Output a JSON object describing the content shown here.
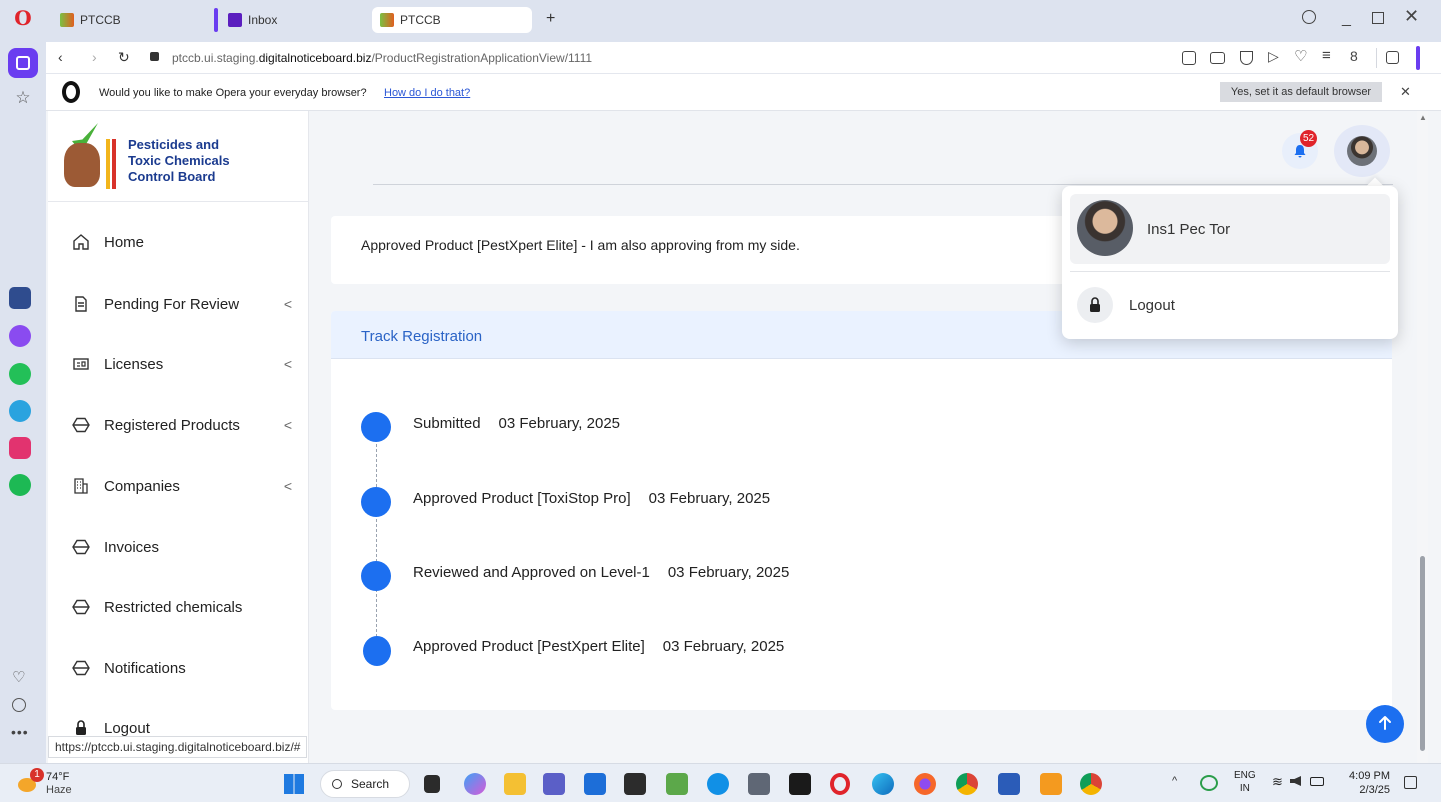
{
  "browser": {
    "tabs": [
      {
        "label": "PTCCB"
      },
      {
        "label": "Inbox"
      },
      {
        "label": "PTCCB"
      }
    ],
    "url_prefix": "ptccb.ui.staging.",
    "url_domain": "digitalnoticeboard.biz",
    "url_path": "/ProductRegistrationApplicationView/1111",
    "infobar": {
      "question": "Would you like to make Opera your everyday browser?",
      "link": "How do I do that?",
      "button": "Yes, set it as default browser"
    },
    "status_url": "https://ptccb.ui.staging.digitalnoticeboard.biz/#"
  },
  "brand": {
    "line1": "Pesticides and",
    "line2": "Toxic Chemicals",
    "line3": "Control Board"
  },
  "sidebar": {
    "items": [
      {
        "label": "Home",
        "icon": "home-icon"
      },
      {
        "label": "Pending For Review",
        "icon": "document-icon",
        "chevron": "<"
      },
      {
        "label": "Licenses",
        "icon": "id-card-icon",
        "chevron": "<"
      },
      {
        "label": "Registered Products",
        "icon": "hexagon-icon",
        "chevron": "<"
      },
      {
        "label": "Companies",
        "icon": "building-icon",
        "chevron": "<"
      },
      {
        "label": "Invoices",
        "icon": "hexagon-icon"
      },
      {
        "label": "Restricted chemicals",
        "icon": "hexagon-icon"
      },
      {
        "label": "Notifications",
        "icon": "hexagon-icon"
      },
      {
        "label": "Logout",
        "icon": "lock-icon"
      }
    ]
  },
  "header": {
    "notification_count": "52"
  },
  "remark": {
    "text": "Approved Product [PestXpert Elite] - I am also approving from my side."
  },
  "track": {
    "title": "Track Registration",
    "events": [
      {
        "label": "Submitted",
        "date": "03 February, 2025"
      },
      {
        "label": "Approved Product [ToxiStop Pro]",
        "date": "03 February, 2025"
      },
      {
        "label": "Reviewed and Approved on Level-1",
        "date": "03 February, 2025"
      },
      {
        "label": "Approved Product [PestXpert Elite]",
        "date": "03 February, 2025"
      }
    ]
  },
  "user_menu": {
    "name": "Ins1 Pec Tor",
    "logout": "Logout"
  },
  "taskbar": {
    "weather_temp": "74°F",
    "weather_desc": "Haze",
    "weather_badge": "1",
    "search": "Search",
    "lang1": "ENG",
    "lang2": "IN",
    "time": "4:09 PM",
    "date": "2/3/25"
  },
  "colors": {
    "primary": "#1c6ff0",
    "badge": "#e0242b",
    "track_header_bg": "#eaf2ff"
  }
}
